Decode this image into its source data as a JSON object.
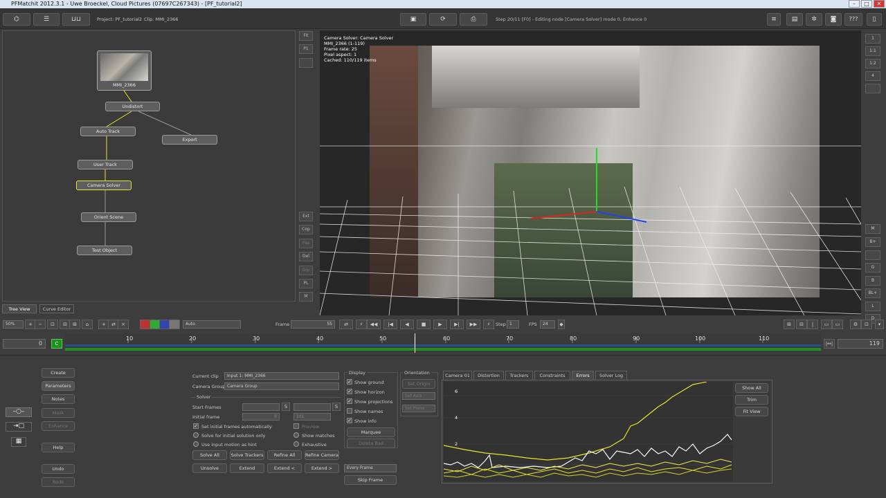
{
  "title": "PFMatchit 2012.3.1 - Uwe Broeckel, Cloud Pictures (07697C267343) - [PF_tutorial2]",
  "window_buttons": [
    "–",
    "□",
    "✕"
  ],
  "header": {
    "project": "Project: PF_tutorial2",
    "clip": "Clip: MMI_2366",
    "status": "Step 20/11 [F0] - Editing node [Camera Solver] mode 0, Enhance 0",
    "help": "???"
  },
  "node_tabs": [
    "Tree View",
    "Curve Editor"
  ],
  "nodes": {
    "clip": "MMI_2366",
    "undistort": "Undistort",
    "auto_track": "Auto Track",
    "export": "Export",
    "user_track": "User Track",
    "camera_solver": "Camera Solver",
    "orient_scene": "Orient Scene",
    "test_object": "Test Object"
  },
  "side_strip": [
    "Fit",
    "P1",
    "",
    "Ext",
    "Cop",
    "Pas",
    "Del",
    "Grp",
    "PL",
    "M"
  ],
  "viewer_info": [
    "Camera Solver: Camera Solver",
    "MMI_2366 (1-119)",
    "Frame rate: 25",
    "Pixel aspect: 1",
    "Cached: 110/119 items"
  ],
  "viewer_right_buttons": [
    "1",
    "1:1",
    "1:2",
    "4",
    "",
    "M",
    "B+",
    "",
    "G",
    "B",
    "BL+",
    "L",
    "D"
  ],
  "toolbar": {
    "zoom": "50%",
    "display_mode": "Auto",
    "frame_label": "Frame",
    "frame_value": "55",
    "step_label": "Step",
    "step_value": "1",
    "fps_label": "FPS",
    "fps_value": "24"
  },
  "timeline": {
    "start": "0",
    "end": "119",
    "ticks": [
      "10",
      "20",
      "30",
      "40",
      "50",
      "60",
      "70",
      "80",
      "90",
      "100",
      "110"
    ],
    "current_frame": 55,
    "total_frames": 119
  },
  "left_buttons": {
    "create": "Create",
    "parameters": "Parameters",
    "notes": "Notes",
    "mask": "Mask",
    "enhance": "Enhance",
    "help": "Help",
    "undo": "Undo",
    "redo": "Redo"
  },
  "solver": {
    "current_clip_label": "Current clip",
    "current_clip_value": "Input 1: MMI_2366",
    "camera_group_label": "Camera Group",
    "camera_group_value": "Camera Group",
    "section": "Solver",
    "start_frames_label": "Start Frames",
    "initial_frame_label": "Initial frame",
    "initial_frame_a": "0",
    "initial_frame_b": "101",
    "opt_set_initial": "Set initial frames automatically",
    "opt_solve_initial": "Solve for initial solution only",
    "opt_use_input_motion": "Use input motion as hint",
    "opt_preview": "Preview",
    "opt_show_matches": "Show matches",
    "opt_exhaustive": "Exhaustive",
    "btn_solve_all": "Solve All",
    "btn_solve_trackers": "Solve Trackers",
    "btn_refine_all": "Refine All",
    "btn_refine_camera": "Refine Camera",
    "btn_unsolve": "Unsolve",
    "btn_extend": "Extend",
    "btn_extend_left": "Extend <",
    "btn_extend_right": "Extend >"
  },
  "display": {
    "title": "Display",
    "items": [
      "Show ground",
      "Show horizon",
      "Show projections",
      "Show names",
      "Show info"
    ],
    "marquee": "Marquee",
    "delete_bad": "Delete Bad",
    "frame_mode": "Every Frame",
    "skip_frame": "Skip Frame"
  },
  "orientation": {
    "title": "Orientation",
    "set_origin": "Set Origin",
    "set_axis": "Set Axis",
    "set_plane": "Set Plane"
  },
  "graph": {
    "tabs": [
      "Camera 01",
      "Distortion",
      "Trackers",
      "Constraints",
      "Errors",
      "Solver Log"
    ],
    "active_tab": "Errors",
    "y_ticks": [
      "6",
      "4",
      "2"
    ],
    "buttons": [
      "Show All",
      "Trim",
      "Fit View"
    ]
  },
  "colors": {
    "accent_yellow": "#e6e62a",
    "timeline_green": "#1f8f1f",
    "timeline_blue": "#2a4f8c"
  }
}
